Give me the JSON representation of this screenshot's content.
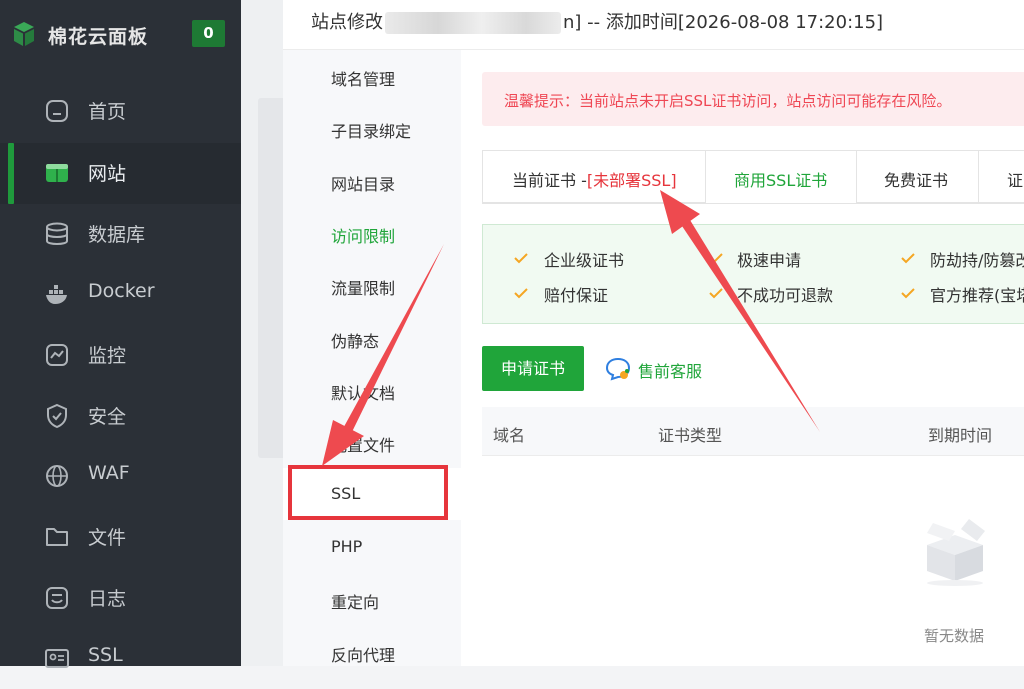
{
  "brand": {
    "name": "棉花云面板",
    "badge": "0"
  },
  "nav": {
    "items": [
      {
        "label": "首页",
        "icon": "home-icon"
      },
      {
        "label": "网站",
        "icon": "website-icon"
      },
      {
        "label": "数据库",
        "icon": "database-icon"
      },
      {
        "label": "Docker",
        "icon": "docker-icon"
      },
      {
        "label": "监控",
        "icon": "monitor-icon"
      },
      {
        "label": "安全",
        "icon": "shield-icon"
      },
      {
        "label": "WAF",
        "icon": "globe-icon"
      },
      {
        "label": "文件",
        "icon": "folder-icon"
      },
      {
        "label": "日志",
        "icon": "log-icon"
      },
      {
        "label": "SSL",
        "icon": "ssl-card-icon"
      }
    ]
  },
  "drawer": {
    "title_prefix": "站点修改",
    "title_suffix": "n] -- 添加时间[2026-08-08 17:20:15]"
  },
  "subnav": {
    "items": [
      {
        "label": "域名管理"
      },
      {
        "label": "子目录绑定"
      },
      {
        "label": "网站目录"
      },
      {
        "label": "访问限制"
      },
      {
        "label": "流量限制"
      },
      {
        "label": "伪静态"
      },
      {
        "label": "默认文档"
      },
      {
        "label": "配置文件"
      },
      {
        "label": "SSL"
      },
      {
        "label": "PHP"
      },
      {
        "label": "重定向"
      },
      {
        "label": "反向代理"
      }
    ]
  },
  "alert": {
    "text": "温馨提示：当前站点未开启SSL证书访问，站点访问可能存在风险。"
  },
  "tabs": {
    "current_prefix": "当前证书 -",
    "current_status": "[未部署SSL]",
    "commercial": "商用SSL证书",
    "free": "免费证书",
    "more": "证"
  },
  "features": [
    {
      "label": "企业级证书"
    },
    {
      "label": "极速申请"
    },
    {
      "label": "防劫持/防篡改"
    },
    {
      "label": "赔付保证"
    },
    {
      "label": "不成功可退款"
    },
    {
      "label": "官方推荐(宝塔"
    }
  ],
  "actions": {
    "apply": "申请证书",
    "presales": "售前客服"
  },
  "table": {
    "columns": [
      "域名",
      "证书类型",
      "到期时间"
    ]
  },
  "empty": {
    "text": "暂无数据"
  },
  "colors": {
    "accent": "#20a53a",
    "warning": "#ef4754",
    "annotation": "#e6353c",
    "nav_bg": "#2b3037"
  }
}
